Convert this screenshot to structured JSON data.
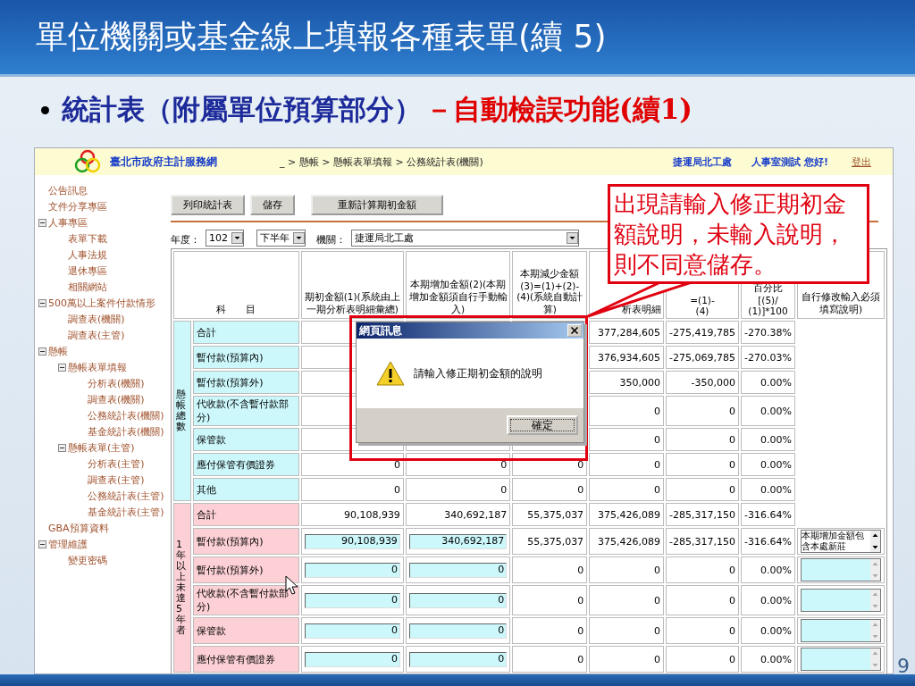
{
  "slide": {
    "title": "單位機關或基金線上填報各種表單(續 5)",
    "bullet": {
      "text": "統計表（附屬單位預算部分）",
      "highlight": "－自動檢誤功能(續1)"
    },
    "page_number": "9"
  },
  "site": {
    "name": "臺北市政府主計服務網",
    "breadcrumb": "_ > 懸帳 > 懸帳表單填報 > 公務統計表(機關)",
    "agency": "捷運局北工處",
    "greeting": "人事室測試 您好!",
    "logout": "登出"
  },
  "sidebar": {
    "items": [
      {
        "label": "公告訊息"
      },
      {
        "label": "文件分享專區"
      },
      {
        "label": "人事專區",
        "expanded": true,
        "children": [
          {
            "label": "表單下載"
          },
          {
            "label": "人事法規"
          },
          {
            "label": "退休專區"
          },
          {
            "label": "相關網站"
          }
        ]
      },
      {
        "label": "500萬以上案件付款情形",
        "expanded": true,
        "children": [
          {
            "label": "調查表(機關)"
          },
          {
            "label": "調查表(主管)"
          }
        ]
      },
      {
        "label": "懸帳",
        "expanded": true,
        "children": [
          {
            "label": "懸帳表單填報",
            "expanded": true,
            "children": [
              {
                "label": "分析表(機關)"
              },
              {
                "label": "調查表(機關)"
              },
              {
                "label": "公務統計表(機關)"
              },
              {
                "label": "基金統計表(機關)"
              }
            ]
          },
          {
            "label": "懸帳表單(主管)",
            "expanded": true,
            "children": [
              {
                "label": "分析表(主管)"
              },
              {
                "label": "調查表(主管)"
              },
              {
                "label": "公務統計表(主管)"
              },
              {
                "label": "基金統計表(主管)"
              }
            ]
          }
        ]
      },
      {
        "label": "GBA預算資料"
      },
      {
        "label": "管理維護",
        "expanded": true,
        "children": [
          {
            "label": "變更密碼"
          }
        ]
      }
    ]
  },
  "toolbar": {
    "buttons": [
      "列印統計表",
      "儲存",
      "重新計算期初金額"
    ]
  },
  "filters": {
    "year_label": "年度：",
    "year": "102",
    "half": "下半年",
    "agency_label": "機關：",
    "agency": "捷運局北工處"
  },
  "table": {
    "columns": [
      "科　　目",
      "期初金額(1)(系統由上一期分析表明細彙總)",
      "本期增加金額(2)(本期增加金額須自行手動輸入)",
      "本期減少金額(3)=(1)+(2)-(4)(系統自動計算)",
      "析表明細",
      "=(1)-\n(4)",
      "百分比[(5)/\n(1)]*100",
      "自行修改輸入必須填寫說明)"
    ],
    "groups": [
      {
        "label": "懸帳總數",
        "color": "#ccf8fc",
        "rows": [
          {
            "subject": "合計",
            "editable": false,
            "values": [
              "377,284,605",
              "-275,419,785",
              "-270.38%"
            ]
          },
          {
            "subject": "暫付款(預算內)",
            "editable": false,
            "values": [
              "376,934,605",
              "-275,069,785",
              "-270.03%"
            ]
          },
          {
            "subject": "暫付款(預算外)",
            "editable": false,
            "values": [
              "350,000",
              "-350,000",
              "0.00%"
            ]
          },
          {
            "subject": "代收款(不含暫付款部分)",
            "editable": false,
            "values": [
              "0",
              "0",
              "0.00%"
            ]
          },
          {
            "subject": "保管款",
            "editable": false,
            "values": [
              "0",
              "0",
              "0.00%"
            ]
          },
          {
            "subject": "應付保管有價證券",
            "editable": false,
            "values": [
              "0",
              "0",
              "0",
              "0",
              "0",
              "0.00%"
            ]
          },
          {
            "subject": "其他",
            "editable": false,
            "values": [
              "0",
              "0",
              "0",
              "0",
              "0",
              "0.00%"
            ]
          }
        ]
      },
      {
        "label": "1年以上未達5年者",
        "color": "#fcd0d4",
        "rows": [
          {
            "subject": "合計",
            "editable": false,
            "values": [
              "90,108,939",
              "340,692,187",
              "55,375,037",
              "375,426,089",
              "-285,317,150",
              "-316.64%"
            ]
          },
          {
            "subject": "暫付款(預算內)",
            "editable": true,
            "note": "本期增加金額包含本處新莊",
            "values": [
              "90,108,939",
              "340,692,187",
              "55,375,037",
              "375,426,089",
              "-285,317,150",
              "-316.64%"
            ]
          },
          {
            "subject": "暫付款(預算外)",
            "editable": true,
            "values": [
              "0",
              "0",
              "0",
              "0",
              "0",
              "0.00%"
            ]
          },
          {
            "subject": "代收款(不含暫付款部分)",
            "editable": true,
            "values": [
              "0",
              "0",
              "0",
              "0",
              "0",
              "0.00%"
            ]
          },
          {
            "subject": "保管款",
            "editable": true,
            "values": [
              "0",
              "0",
              "0",
              "0",
              "0",
              "0.00%"
            ]
          },
          {
            "subject": "應付保管有價證券",
            "editable": true,
            "values": [
              "0",
              "0",
              "0",
              "0",
              "0",
              "0.00%"
            ]
          }
        ]
      }
    ]
  },
  "dialog": {
    "title": "網頁訊息",
    "message": "請輸入修正期初金額的說明",
    "button": "確定"
  },
  "callout": {
    "text": "出現請輸入修正期初金額說明，未輸入說明，則不同意儲存。"
  }
}
